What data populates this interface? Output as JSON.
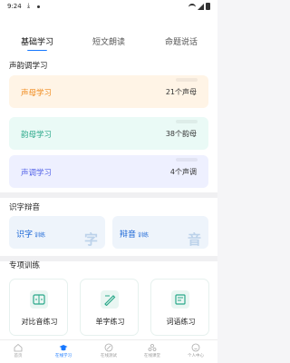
{
  "status": {
    "time": "9:24"
  },
  "tabs": [
    {
      "label": "基础学习",
      "active": true
    },
    {
      "label": "短文朗读",
      "active": false
    },
    {
      "label": "命题说话",
      "active": false
    }
  ],
  "sections": {
    "shengyun": "声韵调学习",
    "shizi": "识字辩音",
    "zhuanxiang": "专项训练"
  },
  "phonetics": [
    {
      "label": "声母学习",
      "count": "21个声母",
      "color": "#f08a1c"
    },
    {
      "label": "韵母学习",
      "count": "38个韵母",
      "color": "#2aa88a"
    },
    {
      "label": "声调学习",
      "count": "4个声调",
      "color": "#5564e8"
    }
  ],
  "recognition": [
    {
      "label": "识字",
      "sub": "训练",
      "big": "字"
    },
    {
      "label": "辩音",
      "sub": "训练",
      "big": "音"
    }
  ],
  "training": [
    {
      "label": "对比音练习",
      "icon": "compare-icon"
    },
    {
      "label": "单字练习",
      "icon": "single-char-icon"
    },
    {
      "label": "词语练习",
      "icon": "words-icon"
    }
  ],
  "nav": [
    {
      "label": "首页",
      "icon": "home-icon",
      "active": false
    },
    {
      "label": "在线学习",
      "icon": "graduation-cap-icon",
      "active": true
    },
    {
      "label": "在线测试",
      "icon": "edit-icon",
      "active": false
    },
    {
      "label": "在线课堂",
      "icon": "class-icon",
      "active": false
    },
    {
      "label": "个人中心",
      "icon": "user-icon",
      "active": false
    }
  ],
  "colors": {
    "accent": "#1677ff",
    "train_icon_bg": "#e9f6f2"
  }
}
